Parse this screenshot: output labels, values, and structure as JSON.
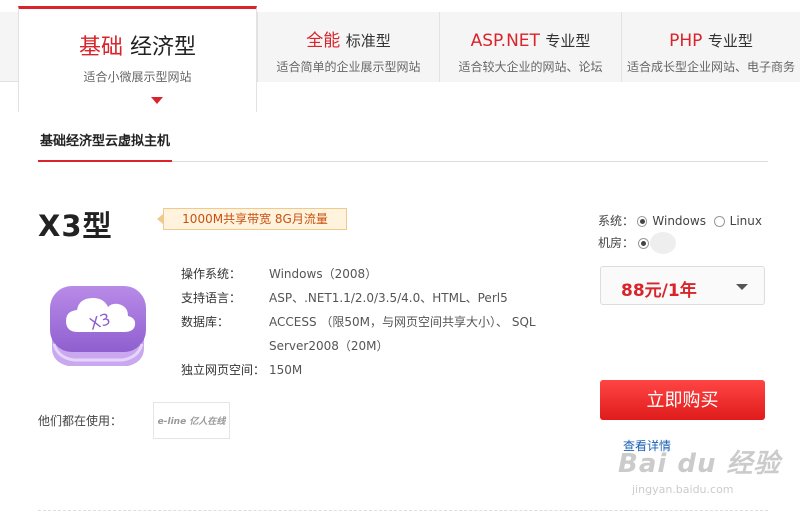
{
  "tabs": [
    {
      "highlight": "基础",
      "rest": "经济型",
      "sub": "适合小微展示型网站",
      "active": true
    },
    {
      "highlight": "全能",
      "rest": "标准型",
      "sub": "适合简单的企业展示型网站",
      "active": false
    },
    {
      "highlight": "ASP.NET",
      "rest": "专业型",
      "sub": "适合较大企业的网站、论坛",
      "active": false
    },
    {
      "highlight": "PHP",
      "rest": "专业型",
      "sub": "适合成长型企业网站、电子商务",
      "active": false
    }
  ],
  "subtab": {
    "label": "基础经济型云虚拟主机"
  },
  "product": {
    "name": "X3型",
    "badge": "1000M共享带宽 8G月流量",
    "icon_text": "X3",
    "specs": [
      {
        "key": "操作系统：",
        "value": "Windows（2008）"
      },
      {
        "key": "支持语言：",
        "value": "ASP、.NET1.1/2.0/3.5/4.0、HTML、Perl5"
      },
      {
        "key": "数据库：",
        "value": "ACCESS （限50M，与网页空间共享大小）、 SQL Server2008（20M）"
      },
      {
        "key": "独立网页空间：",
        "value": "150M"
      }
    ],
    "users_label": "他们都在使用：",
    "partner_logo_text": "e-line 亿人在线"
  },
  "options": {
    "system_label": "系统：",
    "system_options": [
      {
        "label": "Windows",
        "selected": true
      },
      {
        "label": "Linux",
        "selected": false
      }
    ],
    "room_label": "机房：",
    "room_option": {
      "label": "",
      "selected": true
    }
  },
  "price": {
    "value": "88元/1年"
  },
  "buy_button": {
    "label": "立即购买"
  },
  "details_link": {
    "label": "查看详情"
  },
  "watermark": {
    "line1": "Bai du 经验",
    "line2": "jingyan.baidu.com"
  },
  "colors": {
    "accent": "#d8242a",
    "link": "#1a5fb4"
  }
}
